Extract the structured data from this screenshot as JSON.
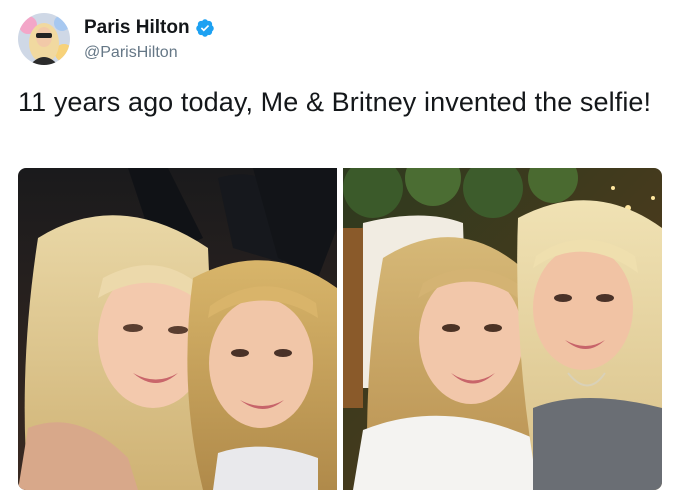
{
  "tweet": {
    "display_name": "Paris Hilton",
    "handle": "@ParisHilton",
    "text": "11 years ago today, Me & Britney invented the selfie!",
    "verified_icon": "verified-badge-icon",
    "colors": {
      "verified_blue": "#1da1f2",
      "text": "#14171a",
      "handle_gray": "#657786"
    }
  },
  "media": {
    "photo_count": 2
  }
}
